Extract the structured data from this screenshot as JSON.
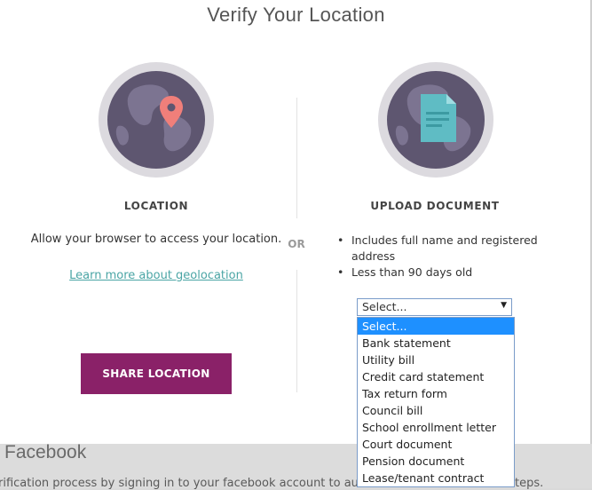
{
  "modal": {
    "title": "Verify Your Location",
    "or_label": "OR"
  },
  "location": {
    "heading": "LOCATION",
    "description": "Allow your browser to access your location.",
    "link": "Learn more about geolocation",
    "button": "SHARE LOCATION",
    "icon": "map-pin-icon"
  },
  "upload": {
    "heading": "UPLOAD DOCUMENT",
    "icon": "document-icon",
    "requirements": [
      "Includes full name and registered address",
      "Less than 90 days old"
    ],
    "select_value": "Select...",
    "options": [
      "Select...",
      "Bank statement",
      "Utility bill",
      "Credit card statement",
      "Tax return form",
      "Council bill",
      "School enrollment letter",
      "Court document",
      "Pension document",
      "Lease/tenant contract"
    ]
  },
  "background": {
    "heading": "Facebook",
    "text_start": "rification process by signing in to your facebook account to auto-c",
    "text_end": "teps."
  },
  "colors": {
    "accent": "#8a2168",
    "link": "#4aa5a5",
    "pin": "#f07f7a",
    "document": "#5fbcc4",
    "globe": "#5e5670",
    "selected_option": "#1e90ff"
  }
}
